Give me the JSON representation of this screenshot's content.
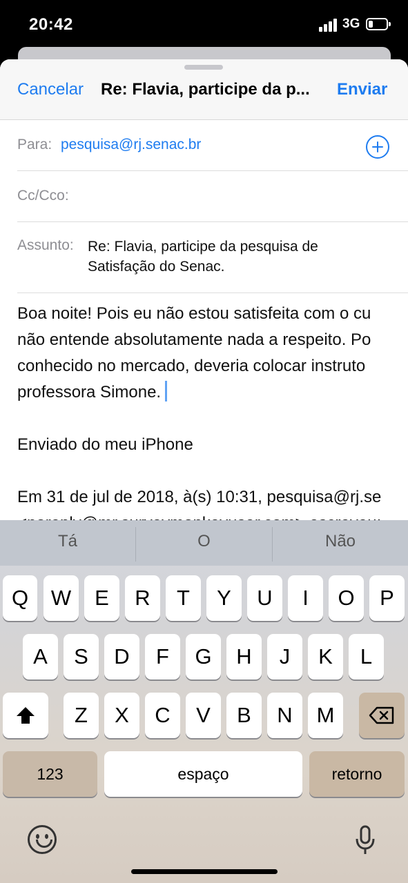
{
  "status_bar": {
    "time": "20:42",
    "network": "3G"
  },
  "compose": {
    "cancel_label": "Cancelar",
    "title": "Re: Flavia, participe da p...",
    "send_label": "Enviar",
    "to_label": "Para:",
    "to_value": "pesquisa@rj.senac.br",
    "cc_label": "Cc/Cco:",
    "subject_label": "Assunto:",
    "subject_lines": [
      "Re: Flavia, participe da pesquisa de",
      "Satisfação do Senac."
    ],
    "body_lines": [
      "Boa noite! Pois eu não estou satisfeita com o cu",
      "não entende absolutamente nada a respeito. Po",
      "conhecido no mercado, deveria colocar instruto",
      "professora  Simone.",
      "",
      "Enviado do meu iPhone",
      "",
      "Em 31 de jul de 2018, à(s) 10:31, pesquisa@rj.se",
      "<noreply@mr.surveymonkeyuser.com> escreveu:"
    ]
  },
  "keyboard": {
    "predictions": [
      "Tá",
      "O",
      "Não"
    ],
    "row1": [
      "Q",
      "W",
      "E",
      "R",
      "T",
      "Y",
      "U",
      "I",
      "O",
      "P"
    ],
    "row2": [
      "A",
      "S",
      "D",
      "F",
      "G",
      "H",
      "J",
      "K",
      "L"
    ],
    "row3": [
      "Z",
      "X",
      "C",
      "V",
      "B",
      "N",
      "M"
    ],
    "numbers_label": "123",
    "space_label": "espaço",
    "return_label": "retorno",
    "shift_icon": "shift-icon",
    "backspace_icon": "backspace-icon",
    "emoji_icon": "emoji-icon",
    "mic_icon": "microphone-icon"
  },
  "colors": {
    "accent": "#1e7cf0"
  }
}
